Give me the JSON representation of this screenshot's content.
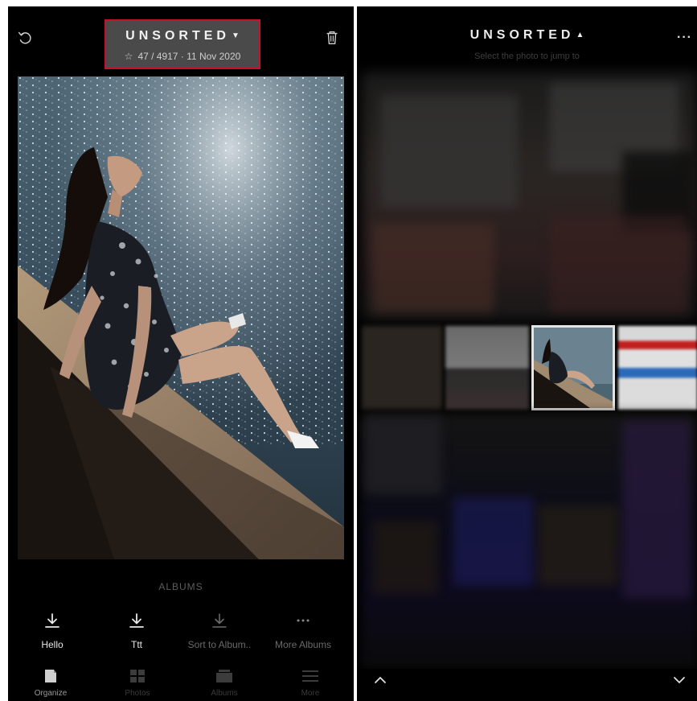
{
  "header": {
    "title": "UNSORTED",
    "title_caret": "▼",
    "star": "☆",
    "info": "47 / 4917 · 11 Nov 2020"
  },
  "albums": {
    "section_title": "ALBUMS",
    "items": [
      {
        "label": "Hello",
        "icon": "download-icon"
      },
      {
        "label": "Ttt",
        "icon": "download-icon"
      },
      {
        "label": "Sort to Album..",
        "icon": "download-icon"
      },
      {
        "label": "More Albums",
        "icon": "more-icon"
      }
    ]
  },
  "tabs": [
    {
      "label": "Organize",
      "icon": "organize-icon",
      "active": true
    },
    {
      "label": "Photos",
      "icon": "grid-icon"
    },
    {
      "label": "Albums",
      "icon": "albums-icon"
    },
    {
      "label": "More",
      "icon": "menu-icon"
    }
  ],
  "jump": {
    "title": "UNSORTED",
    "title_caret": "▲",
    "subtitle": "Select the photo to jump to",
    "more": "···"
  },
  "colors": {
    "highlight_border": "#c8102e",
    "title_bg": "#4a4a4a",
    "background": "#000000"
  }
}
